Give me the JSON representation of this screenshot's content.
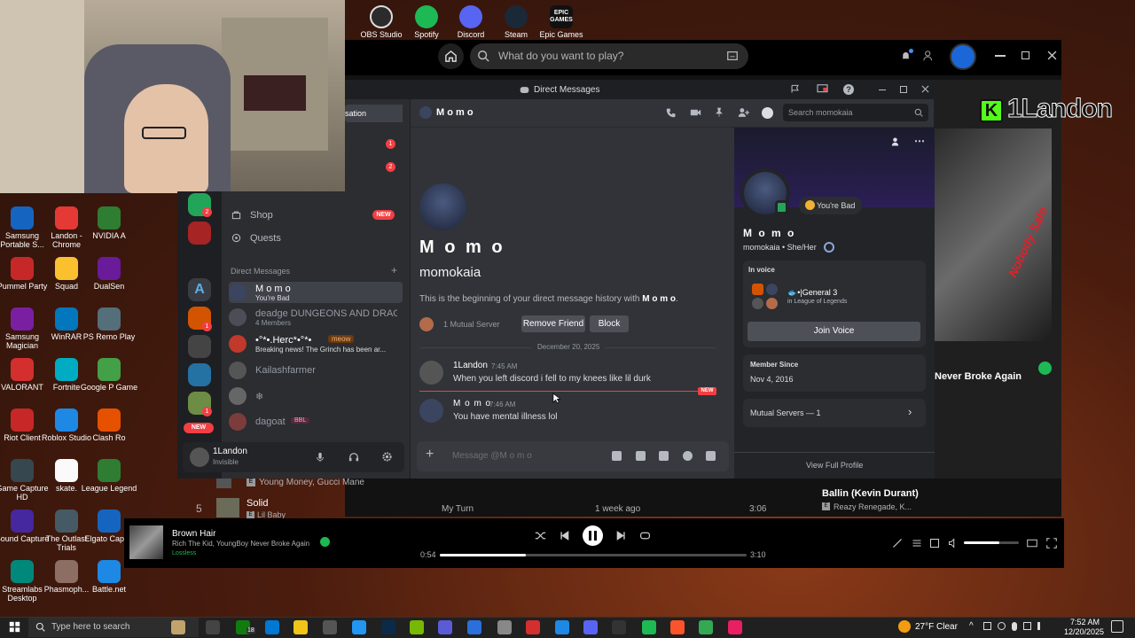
{
  "desktop": {
    "top_icons": [
      "OBS Studio",
      "Spotify",
      "Discord",
      "Steam",
      "Epic Games"
    ],
    "epic_logo": "EPIC GAMES",
    "left_icons": [
      [
        "Samsung Portable S...",
        "Landon - Chrome",
        "NVIDIA A"
      ],
      [
        "Pummel Party",
        "Squad",
        "DualSen"
      ],
      [
        "Samsung Magician",
        "WinRAR",
        "PS Remo Play"
      ],
      [
        "VALORANT",
        "Fortnite",
        "Google P Game"
      ],
      [
        "Riot Client",
        "Roblox Studio",
        "Clash Ro"
      ],
      [
        "Game Capture HD",
        "skate.",
        "League Legend"
      ],
      [
        "Sound Capture",
        "The Outlast Trials",
        "Elgato Captur"
      ],
      [
        "Streamlabs Desktop",
        "Phasmoph...",
        "Battle.net"
      ]
    ]
  },
  "streamer_tag": "1Landon",
  "spotify": {
    "search_placeholder": "What do you want to play?",
    "artist_card_title": "Never Broke Again",
    "album_art_text": "Nobody Safe",
    "track_rows": [
      {
        "num": "",
        "title": "",
        "artist": "Young Money, Gucci Mane",
        "album": "",
        "date": "",
        "duration": ""
      },
      {
        "num": "5",
        "title": "Solid",
        "artist": "Lil Baby",
        "album": "My Turn",
        "date": "1 week ago",
        "duration": "3:06"
      }
    ],
    "next_up": {
      "title": "Ballin (Kevin Durant)",
      "artist": "Reazy Renegade, K..."
    },
    "now_playing": {
      "title": "Brown Hair",
      "artists": "Rich The Kid, YoungBoy Never Broke Again",
      "quality": "Lossless",
      "elapsed": "0:54",
      "total": "3:10",
      "progress": 0.28,
      "volume": 0.65
    },
    "accent": "#1db954"
  },
  "discord": {
    "window_title": "Direct Messages",
    "partial_tab": "sation",
    "badges": [
      "1",
      "2"
    ],
    "nav": [
      {
        "label": "Shop",
        "badge": "NEW"
      },
      {
        "label": "Quests"
      }
    ],
    "dm_header": "Direct Messages",
    "dms": [
      {
        "name": "M o m o",
        "status": "You're Bad",
        "active": true
      },
      {
        "name": "deadge DUNGEONS AND DRAG...",
        "status": "4 Members"
      },
      {
        "name": "•°*•.Herc*•°*•",
        "status": "Breaking news! The Grinch has been ar...",
        "tag": "meow"
      },
      {
        "name": "Kailashfarmer",
        "status": ""
      },
      {
        "name": "❄",
        "status": ""
      },
      {
        "name": "dagoat",
        "status": "",
        "tag": "BBL"
      }
    ],
    "guild_badges": [
      "2",
      "1",
      "1",
      "1"
    ],
    "guild_new": "NEW",
    "user": {
      "name": "1Landon",
      "status": "Invisible"
    },
    "chat": {
      "channel_name": "M o m o",
      "search_placeholder": "Search momokaia",
      "intro_name": "M o m o",
      "intro_username": "momokaia",
      "intro_text_prefix": "This is the beginning of your direct message history with ",
      "intro_text_name": "M o m o",
      "intro_text_suffix": ".",
      "mutual_servers": "1 Mutual Server",
      "remove_friend": "Remove Friend",
      "block": "Block",
      "date_divider": "December 20, 2025",
      "new_label": "NEW",
      "messages": [
        {
          "author": "1Landon",
          "time": "7:45 AM",
          "text": "When you left discord i fell to my knees like lil durk"
        },
        {
          "author": "M o m o",
          "time": "7:46 AM",
          "text": "You have mental illness lol"
        }
      ],
      "input_placeholder": "Message @M o m o"
    },
    "profile": {
      "display_name": "M o m o",
      "username": "momokaia",
      "pronouns": "She/Her",
      "custom_status": "You're Bad",
      "in_voice_label": "In voice",
      "voice_channel": "General 3",
      "voice_channel_prefix": "🐟•|",
      "voice_server": "in League of Legends",
      "join_voice": "Join Voice",
      "member_since_label": "Member Since",
      "member_since": "Nov 4, 2016",
      "mutual_servers": "Mutual Servers — 1",
      "view_full": "View Full Profile"
    }
  },
  "taskbar": {
    "search_placeholder": "Type here to search",
    "weather": "27°F  Clear",
    "time": "7:52 AM",
    "date": "12/20/2025",
    "xbox_badge": "18"
  }
}
